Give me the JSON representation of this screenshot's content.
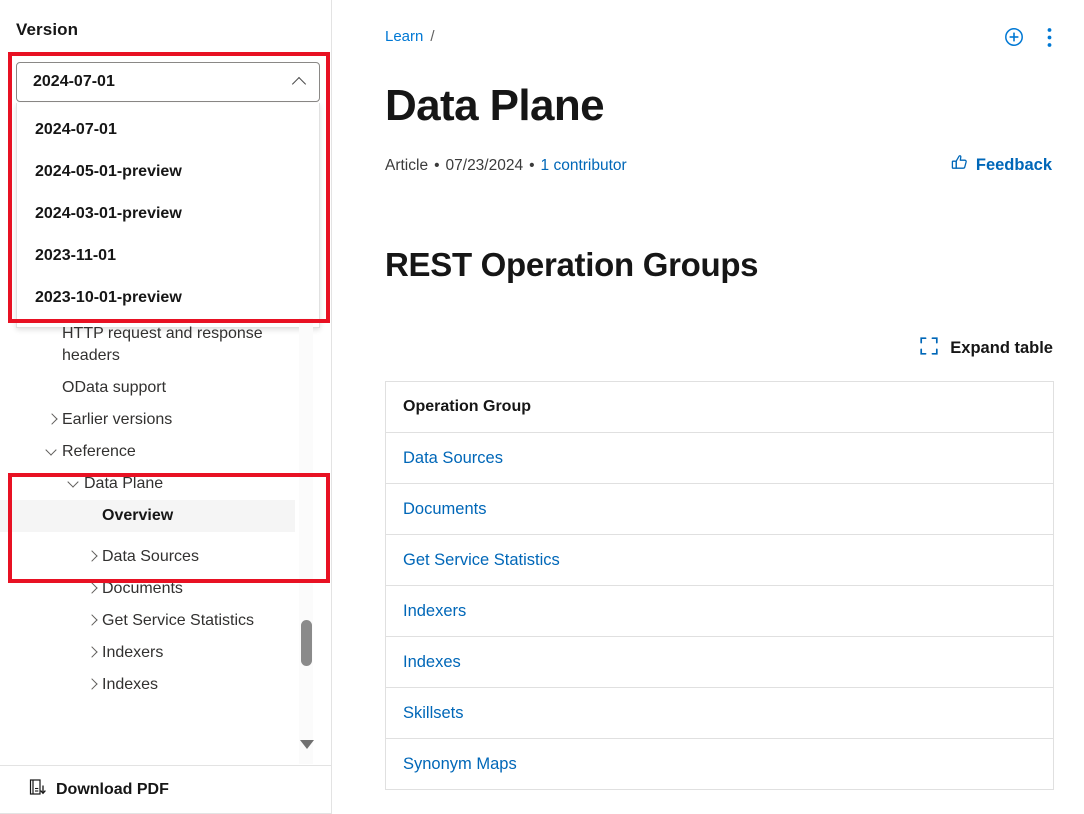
{
  "sidebar": {
    "version_label": "Version",
    "version_select": {
      "value": "2024-07-01",
      "chevron_icon": "chevron-up-icon",
      "options": [
        "2024-07-01",
        "2024-05-01-preview",
        "2024-03-01-preview",
        "2023-11-01",
        "2023-10-01-preview"
      ]
    },
    "nav_items": [
      {
        "label": "HTTP request and response headers",
        "indent": 2,
        "chevron": "none",
        "active": false
      },
      {
        "label": "OData support",
        "indent": 2,
        "chevron": "none",
        "active": false
      },
      {
        "label": "Earlier versions",
        "indent": 1,
        "chevron": "right",
        "active": false
      },
      {
        "label": "Reference",
        "indent": 1,
        "chevron": "down",
        "active": false
      },
      {
        "label": "Data Plane",
        "indent": 2,
        "chevron": "down",
        "active": false
      },
      {
        "label": "Overview",
        "indent": 3,
        "chevron": "none",
        "active": true
      },
      {
        "label": "Data Sources",
        "indent": 3,
        "chevron": "right",
        "active": false
      },
      {
        "label": "Documents",
        "indent": 3,
        "chevron": "right",
        "active": false
      },
      {
        "label": "Get Service Statistics",
        "indent": 3,
        "chevron": "right",
        "active": false
      },
      {
        "label": "Indexers",
        "indent": 3,
        "chevron": "right",
        "active": false
      },
      {
        "label": "Indexes",
        "indent": 3,
        "chevron": "right",
        "active": false
      }
    ],
    "footer": {
      "download_pdf_label": "Download PDF",
      "download_pdf_icon": "download-pdf-icon"
    },
    "scrollbar": {
      "thumb_icon": "scrollbar-thumb",
      "down_arrow_icon": "scroll-down-arrow-icon"
    }
  },
  "header": {
    "breadcrumb": {
      "items": [
        "Learn"
      ],
      "separator": "/"
    },
    "actions": [
      {
        "name": "add-to-collection-button",
        "icon": "plus-circle-icon"
      },
      {
        "name": "more-actions-button",
        "icon": "more-vertical-icon"
      }
    ]
  },
  "article": {
    "title": "Data Plane",
    "type_label": "Article",
    "date": "07/23/2024",
    "contributors": "1 contributor",
    "separator": "•",
    "feedback": {
      "label": "Feedback",
      "icon": "thumbs-up-icon"
    }
  },
  "main": {
    "section_title": "REST Operation Groups",
    "expand_table": {
      "label": "Expand table",
      "icon": "expand-icon"
    },
    "table": {
      "columns": [
        "Operation Group"
      ],
      "rows": [
        "Data Sources",
        "Documents",
        "Get Service Statistics",
        "Indexers",
        "Indexes",
        "Skillsets",
        "Synonym Maps"
      ]
    }
  },
  "annotations": [
    {
      "name": "version-dropdown-highlight",
      "color": "#e81123"
    },
    {
      "name": "reference-nav-highlight",
      "color": "#e81123"
    }
  ],
  "colors": {
    "link": "#0067b8",
    "accent": "#0078d4",
    "annotation": "#e81123",
    "active_nav_bg": "#f5f5f5",
    "text": "#161616"
  }
}
